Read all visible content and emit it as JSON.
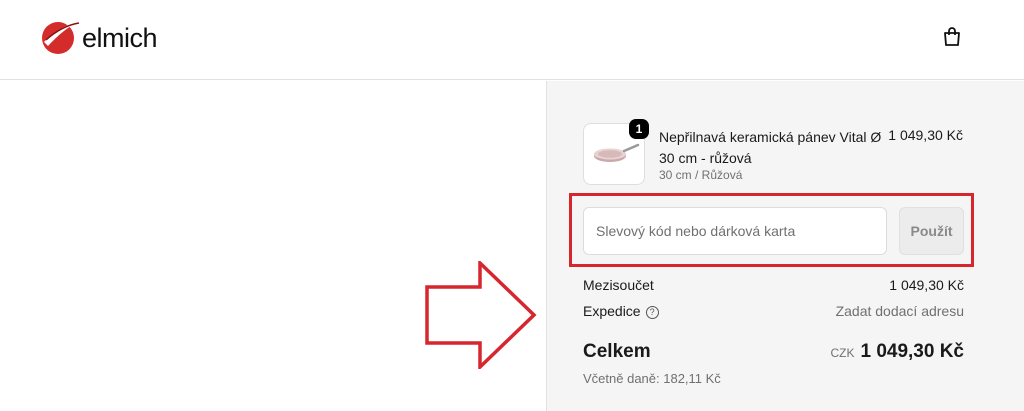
{
  "header": {
    "logo_text": "elmich",
    "cart_icon": "shopping-bag-icon"
  },
  "product": {
    "quantity": "1",
    "name": "Nepřilnavá keramická pánev Vital Ø 30 cm - růžová",
    "variant": "30 cm / Růžová",
    "price": "1 049,30 Kč",
    "image_icon": "frying-pan-image"
  },
  "discount": {
    "placeholder": "Slevový kód nebo dárková karta",
    "value": "",
    "apply_label": "Použít"
  },
  "summary": {
    "subtotal_label": "Mezisoučet",
    "subtotal_value": "1 049,30 Kč",
    "shipping_label": "Expedice",
    "shipping_value": "Zadat dodací adresu",
    "total_label": "Celkem",
    "currency": "CZK",
    "total_value": "1 049,30 Kč",
    "tax_note": "Včetně daně: 182,11 Kč"
  },
  "colors": {
    "annotation_red": "#d6262e",
    "logo_red": "#d42b2b"
  }
}
